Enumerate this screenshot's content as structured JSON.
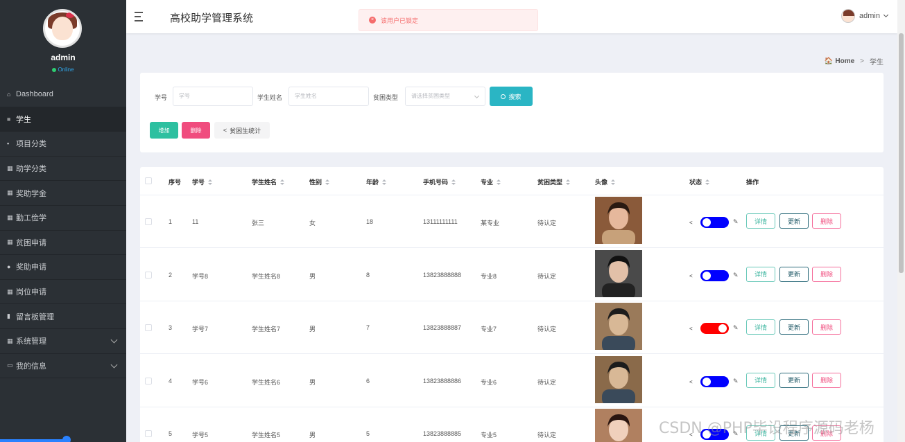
{
  "sidebar": {
    "username": "admin",
    "status": "Online",
    "items": [
      {
        "icon": "⌂",
        "label": "Dashboard",
        "active": false,
        "expandable": false
      },
      {
        "icon": "≡",
        "label": "学生",
        "active": true,
        "expandable": false
      },
      {
        "icon": "▪",
        "label": "项目分类",
        "active": false,
        "expandable": false
      },
      {
        "icon": "▦",
        "label": "助学分类",
        "active": false,
        "expandable": false
      },
      {
        "icon": "▦",
        "label": "奖助学金",
        "active": false,
        "expandable": false
      },
      {
        "icon": "▦",
        "label": "勤工俭学",
        "active": false,
        "expandable": false
      },
      {
        "icon": "▦",
        "label": "贫困申请",
        "active": false,
        "expandable": false
      },
      {
        "icon": "●",
        "label": "奖助申请",
        "active": false,
        "expandable": false
      },
      {
        "icon": "▦",
        "label": "岗位申请",
        "active": false,
        "expandable": false
      },
      {
        "icon": "▮",
        "label": "留言板管理",
        "active": false,
        "expandable": false
      },
      {
        "icon": "▦",
        "label": "系统管理",
        "active": false,
        "expandable": true
      },
      {
        "icon": "▭",
        "label": "我的信息",
        "active": false,
        "expandable": true
      }
    ]
  },
  "header": {
    "title": "高校助学管理系统",
    "user": "admin"
  },
  "toast": {
    "message": "该用户已锁定",
    "color": "#f56c6c"
  },
  "breadcrumb": {
    "home": "Home",
    "sep": ">",
    "current": "学生"
  },
  "search": {
    "student_no_label": "学号",
    "student_no_placeholder": "学号",
    "name_label": "学生姓名",
    "name_placeholder": "学生姓名",
    "poverty_label": "贫困类型",
    "poverty_placeholder": "请选择贫困类型",
    "search_button": "搜索"
  },
  "actions": {
    "add": "增加",
    "delete": "删除",
    "stats": "贫困生统计"
  },
  "table": {
    "headers": [
      "序号",
      "学号",
      "学生姓名",
      "性别",
      "年龄",
      "手机号码",
      "专业",
      "贫困类型",
      "头像",
      "状态",
      "操作"
    ],
    "rows": [
      {
        "idx": "1",
        "no": "11",
        "name": "张三",
        "gender": "女",
        "age": "18",
        "phone": "13111111111",
        "major": "某专业",
        "poverty": "待认定",
        "locked": false
      },
      {
        "idx": "2",
        "no": "学号8",
        "name": "学生姓名8",
        "gender": "男",
        "age": "8",
        "phone": "13823888888",
        "major": "专业8",
        "poverty": "待认定",
        "locked": false
      },
      {
        "idx": "3",
        "no": "学号7",
        "name": "学生姓名7",
        "gender": "男",
        "age": "7",
        "phone": "13823888887",
        "major": "专业7",
        "poverty": "待认定",
        "locked": true
      },
      {
        "idx": "4",
        "no": "学号6",
        "name": "学生姓名6",
        "gender": "男",
        "age": "6",
        "phone": "13823888886",
        "major": "专业6",
        "poverty": "待认定",
        "locked": false
      },
      {
        "idx": "5",
        "no": "学号5",
        "name": "学生姓名5",
        "gender": "男",
        "age": "5",
        "phone": "13823888885",
        "major": "专业5",
        "poverty": "待认定",
        "locked": false
      }
    ],
    "row_actions": {
      "detail": "详情",
      "update": "更新",
      "remove": "删除"
    }
  },
  "colors": {
    "sidebar_bg": "#2b3035",
    "toggle_on": "#ff0000",
    "toggle_off": "#0000ff",
    "search_btn": "#2ab5c4",
    "add_btn": "#2dc0a0",
    "delete_btn": "#f04c7e"
  },
  "watermark": "CSDN @PHP毕设程序源码老杨"
}
